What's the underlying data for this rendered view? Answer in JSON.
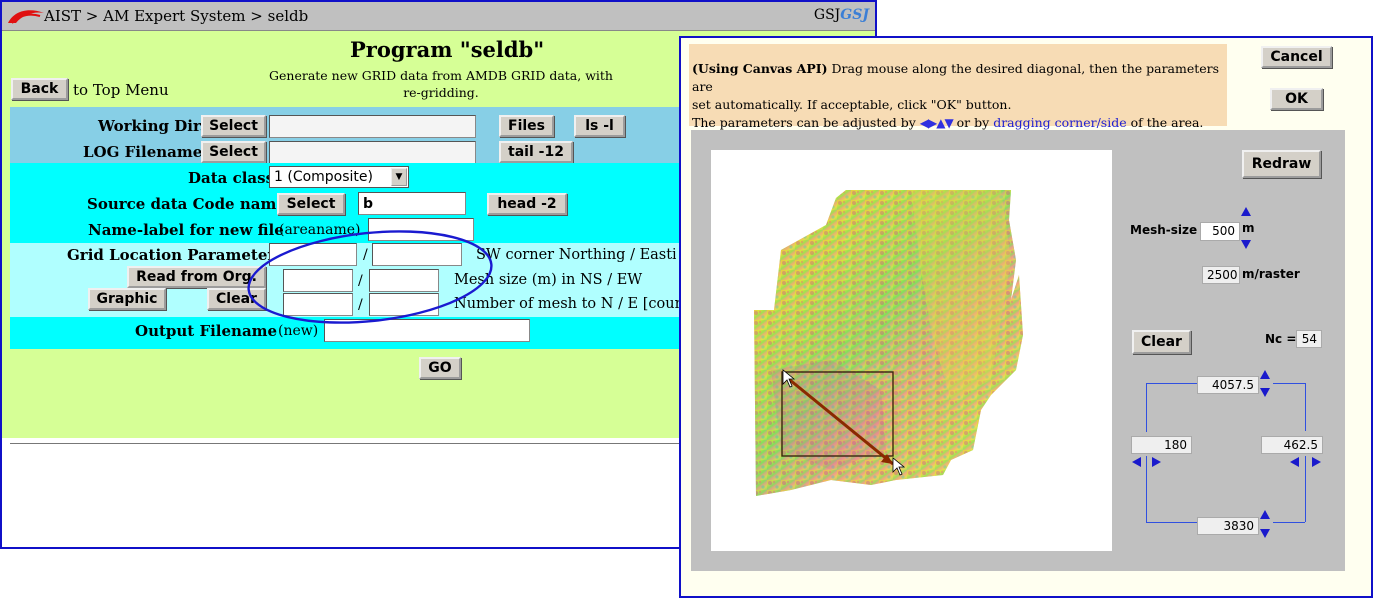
{
  "titlebar": {
    "breadcrumb": "AIST > AM Expert System > seldb",
    "brand_text": "GSJ",
    "brand_logo": "GSJ"
  },
  "header": {
    "title": "Program \"seldb\"",
    "subtitle_line1": "Generate new GRID data from AMDB GRID data, with",
    "subtitle_line2": "re-gridding.",
    "back_label": "Back",
    "back_suffix": "to Top Menu"
  },
  "form": {
    "working_dir": {
      "label": "Working Dir.",
      "select_label": "Select",
      "value": "",
      "files_label": "Files",
      "ls_label": "ls -l"
    },
    "log_filename": {
      "label": "LOG Filename",
      "select_label": "Select",
      "value": "",
      "tail_label": "tail -12"
    },
    "data_class": {
      "label": "Data class",
      "selected": "1 (Composite)"
    },
    "source_code": {
      "label": "Source data Code name",
      "select_label": "Select",
      "value": "b",
      "head_label": "head -2"
    },
    "name_label": {
      "label": "Name-label for new file",
      "hint": "(areaname)",
      "value": ""
    },
    "grid_location": {
      "label": "Grid Location Parameters",
      "read_label": "Read from Org.",
      "graphic_label": "Graphic",
      "clear_label": "Clear",
      "row1_desc": "SW corner Northing / Easting",
      "row2_desc": "Mesh size (m) in NS / EW",
      "row3_desc": "Number of mesh to N / E [count]",
      "separator": "/"
    },
    "output_filename": {
      "label": "Output Filename",
      "hint": "(new)",
      "value": ""
    },
    "go_label": "GO"
  },
  "dialog": {
    "instr_bold": "(Using Canvas API)",
    "instr_line1": " Drag mouse along the desired diagonal, then the parameters are",
    "instr_line2": "set automatically.   If acceptable, click \"OK\" button.",
    "instr_line3_a": "The parameters can be adjusted by ",
    "instr_arrows": "◀▶▲▼",
    "instr_line3_b": " or by ",
    "instr_link": "dragging corner/side",
    "instr_line3_c": " of the area.",
    "cancel_label": "Cancel",
    "ok_label": "OK",
    "redraw_label": "Redraw",
    "mesh_size_label": "Mesh-size :",
    "mesh_size_value": "500",
    "mesh_size_unit": "m",
    "raster_value": "2500",
    "raster_unit": "m/raster",
    "clear_label": "Clear",
    "nc_label": "Nc =",
    "nc_value": "54",
    "north_value": "4057.5",
    "west_value": "180",
    "east_value": "462.5",
    "south_value": "3830"
  },
  "colors": {
    "form_bg": "#d6ff96",
    "band_blue": "#87cfe6",
    "band_cyan": "#00ffff",
    "band_light_cyan": "#b0ffff",
    "border_blue": "#1010c8",
    "instr_bg": "#f7dcb5",
    "arrow_blue": "#1a1acc"
  }
}
